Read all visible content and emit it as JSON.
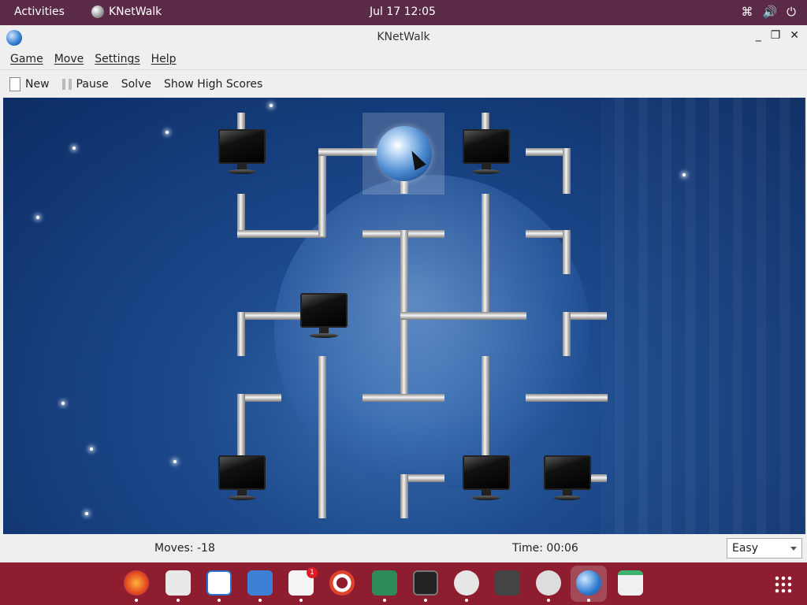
{
  "topbar": {
    "activities": "Activities",
    "app_name": "KNetWalk",
    "clock": "Jul 17  12:05",
    "tray_icons": [
      "network-icon",
      "volume-icon",
      "power-icon"
    ]
  },
  "window": {
    "title": "KNetWalk",
    "controls": [
      "minimize",
      "maximize",
      "close"
    ]
  },
  "menubar": {
    "items": [
      "Game",
      "Move",
      "Settings",
      "Help"
    ]
  },
  "toolbar": {
    "new_label": "New",
    "pause_label": "Pause",
    "solve_label": "Solve",
    "highscores_label": "Show High Scores"
  },
  "status": {
    "moves": "Moves: -18",
    "time": "Time: 00:06",
    "difficulty": "Easy"
  },
  "dock": {
    "apps": [
      "firefox",
      "evolution",
      "writer",
      "files",
      "software",
      "help",
      "game",
      "terminal",
      "robot",
      "vm",
      "settings",
      "knetwalk",
      "trash"
    ],
    "software_badge": "1"
  }
}
